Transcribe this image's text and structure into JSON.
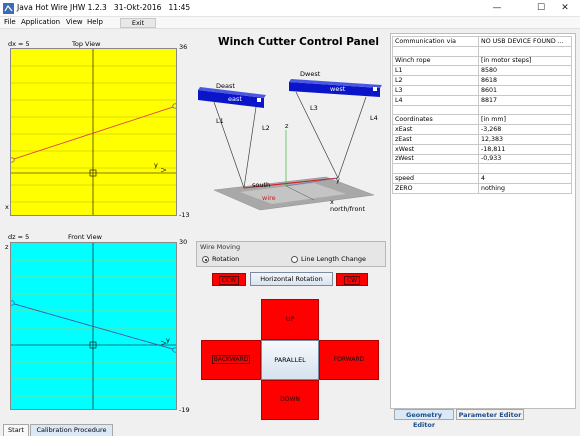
{
  "window": {
    "title": "Java Hot Wire JHW 1.2.3",
    "date": "31-Okt-2016",
    "time": "11:45",
    "minimize": "—",
    "maximize": "☐",
    "close": "✕"
  },
  "menu": {
    "file": "File",
    "application": "Application",
    "view": "View",
    "help": "Help",
    "exit": "Exit"
  },
  "panel_title": "Winch Cutter Control Panel",
  "top_view": {
    "caption_left": "dx = 5",
    "caption_title": "Top View",
    "y_max": "36",
    "y_min": "-13",
    "axis_y": "y",
    "axis_x": "x"
  },
  "front_view": {
    "caption_left": "dz = 5",
    "caption_title": "Front View",
    "y_max": "30",
    "y_min": "-19",
    "axis_y": "y",
    "axis_z": "z"
  },
  "diagram": {
    "deast": "Deast",
    "dwest": "Dwest",
    "east": "east",
    "west": "west",
    "l1": "L1",
    "l2": "L2",
    "l3": "L3",
    "l4": "L4",
    "south": "south",
    "wire": "wire",
    "north_front": "north/front",
    "z": "z",
    "y": "y",
    "x": "x"
  },
  "wire_moving": {
    "legend": "Wire Moving",
    "rotation": "Rotation",
    "line_length": "Line Length Change",
    "selected": "Rotation"
  },
  "controls": {
    "ccw": "CCW",
    "horizontal_rotation": "Horizontal Rotation",
    "cw": "CW",
    "up": "UP",
    "down": "DOWN",
    "backward": "BACKWARD",
    "forward": "FORWARD",
    "parallel": "PARALLEL"
  },
  "info_table": [
    [
      "Communication via",
      "NO USB DEVICE FOUND ..."
    ],
    [
      "",
      ""
    ],
    [
      "Winch rope",
      "[in motor steps]"
    ],
    [
      "L1",
      "8580"
    ],
    [
      "L2",
      "8618"
    ],
    [
      "L3",
      "8601"
    ],
    [
      "L4",
      "8817"
    ],
    [
      "",
      ""
    ],
    [
      "Coordinates",
      "[in mm]"
    ],
    [
      "xEast",
      "-3,268"
    ],
    [
      "zEast",
      "12,383"
    ],
    [
      "xWest",
      "-18,811"
    ],
    [
      "zWest",
      "-0,933"
    ],
    [
      "",
      ""
    ],
    [
      "speed",
      "4"
    ],
    [
      "ZERO",
      "nothing"
    ]
  ],
  "right_tabs": {
    "geometry": "Geometry Editor",
    "parameter": "Parameter Editor"
  },
  "bottom_tabs": {
    "start": "Start",
    "calibration": "Calibration Procedure"
  },
  "colors": {
    "top_plot_bg": "#ffff00",
    "front_plot_bg": "#00ffff",
    "button_red": "#ff0000",
    "winch_blue": "#0a14c8"
  }
}
